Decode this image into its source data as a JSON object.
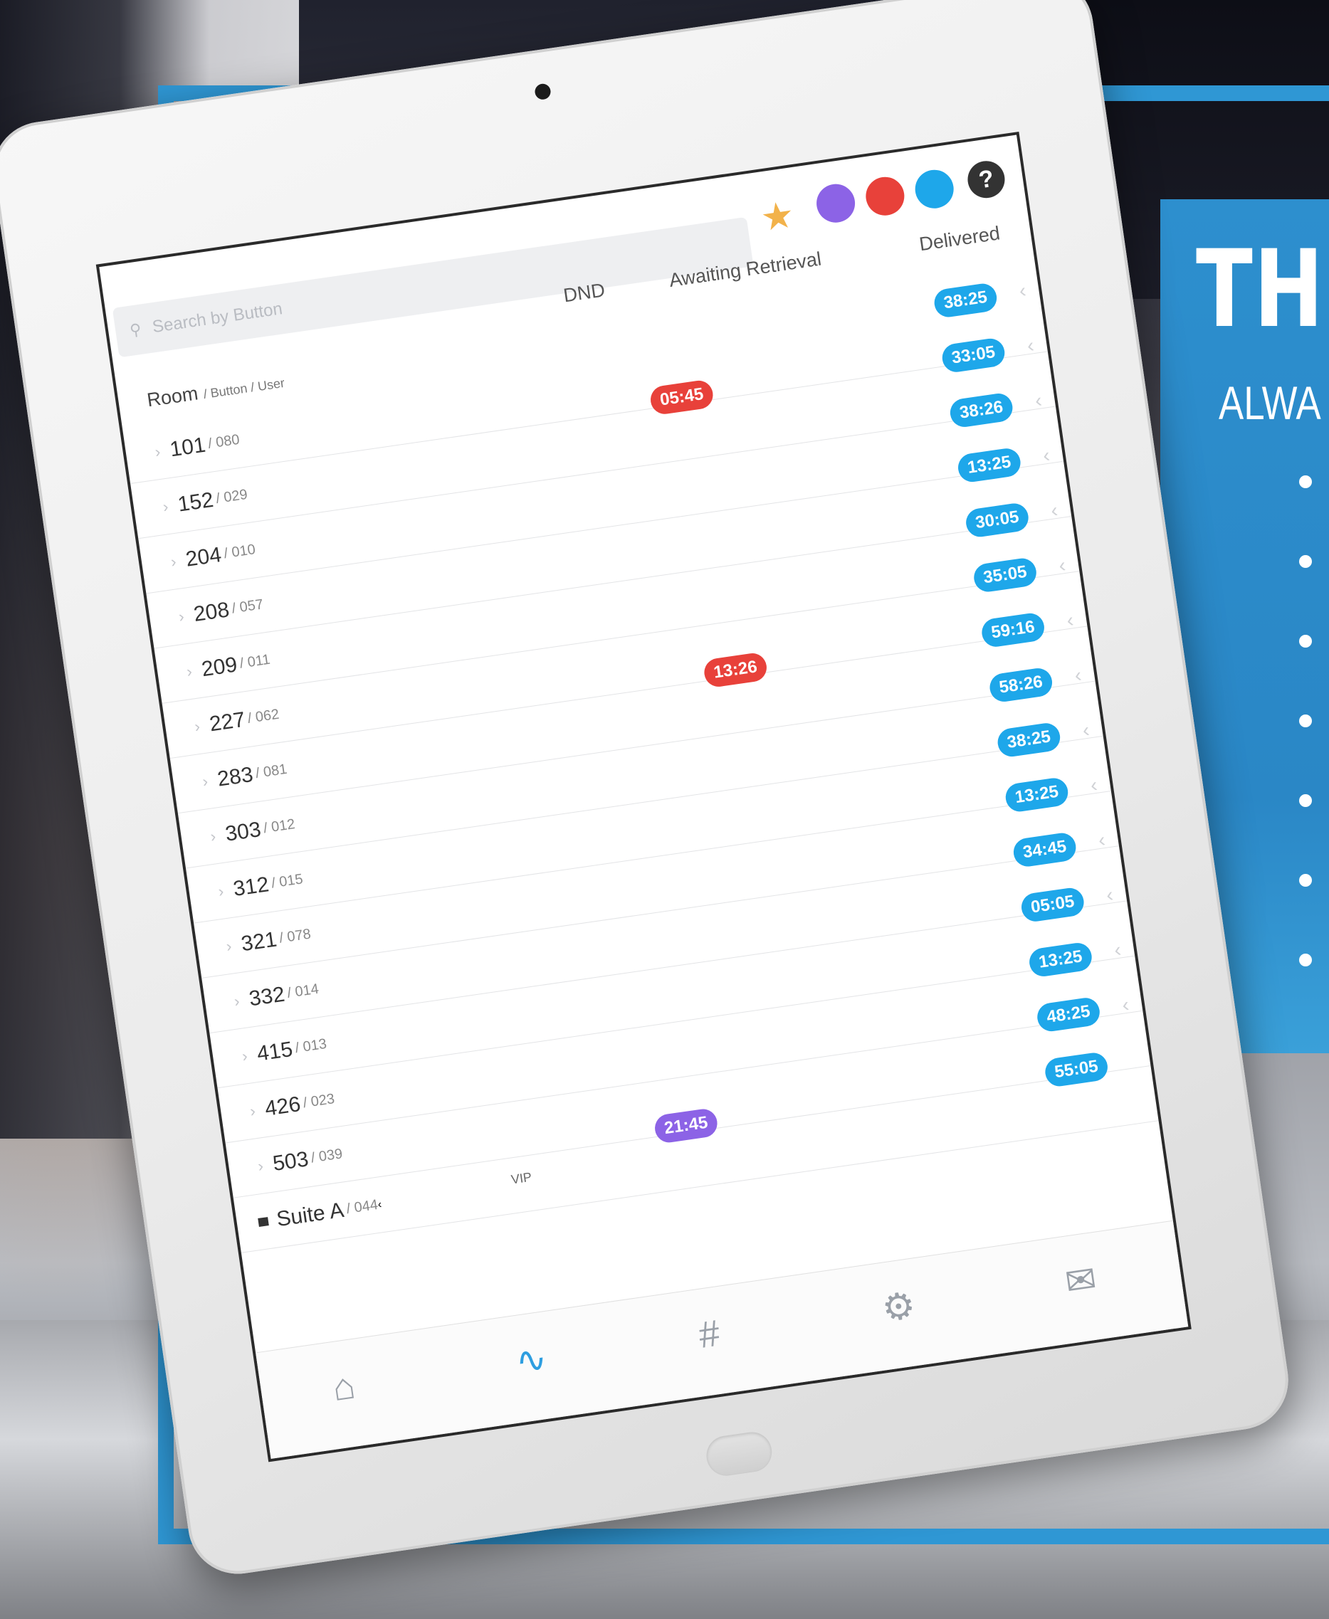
{
  "promo": {
    "title": "THE",
    "subtitle": "ALWA",
    "bullet_count": 7
  },
  "toolbar": {
    "search_placeholder": "Search by Button",
    "help_label": "?",
    "status_colors": [
      "#8c63e6",
      "#e8413a",
      "#1ea7ea"
    ],
    "star_color": "#f2b24a"
  },
  "table": {
    "columns": {
      "dnd": "DND",
      "awaiting": "Awaiting Retrieval",
      "delivered": "Delivered"
    },
    "room_header": "Room",
    "room_header_sub": "/ Button / User",
    "rows": [
      {
        "room": "101",
        "button": "/ 080",
        "delivered": "38:25",
        "awaiting": "05:45"
      },
      {
        "room": "152",
        "button": "/ 029",
        "delivered": "33:05",
        "awaiting": ""
      },
      {
        "room": "204",
        "button": "/ 010",
        "delivered": "38:26",
        "awaiting": ""
      },
      {
        "room": "208",
        "button": "/ 057",
        "delivered": "13:25",
        "awaiting": ""
      },
      {
        "room": "209",
        "button": "/ 011",
        "delivered": "30:05",
        "awaiting": ""
      },
      {
        "room": "227",
        "button": "/ 062",
        "delivered": "35:05",
        "awaiting": "13:26"
      },
      {
        "room": "283",
        "button": "/ 081",
        "delivered": "59:16",
        "awaiting": ""
      },
      {
        "room": "303",
        "button": "/ 012",
        "delivered": "58:26",
        "awaiting": ""
      },
      {
        "room": "312",
        "button": "/ 015",
        "delivered": "38:25",
        "awaiting": ""
      },
      {
        "room": "321",
        "button": "/ 078",
        "delivered": "13:25",
        "awaiting": ""
      },
      {
        "room": "332",
        "button": "/ 014",
        "delivered": "34:45",
        "awaiting": ""
      },
      {
        "room": "415",
        "button": "/ 013",
        "delivered": "05:05",
        "awaiting": ""
      },
      {
        "room": "426",
        "button": "/ 023",
        "delivered": "13:25",
        "awaiting": ""
      },
      {
        "room": "503",
        "button": "/ 039",
        "delivered": "48:25",
        "awaiting": "21:45"
      }
    ],
    "suite": {
      "room": "Suite A",
      "button": "/ 044",
      "tag": "VIP",
      "delivered": "55:05"
    }
  },
  "tabs": [
    {
      "name": "home",
      "icon": "home-icon"
    },
    {
      "name": "activity",
      "icon": "pulse-icon"
    },
    {
      "name": "grid",
      "icon": "hash-icon"
    },
    {
      "name": "settings",
      "icon": "gear-icon"
    },
    {
      "name": "messages",
      "icon": "mail-icon"
    }
  ]
}
